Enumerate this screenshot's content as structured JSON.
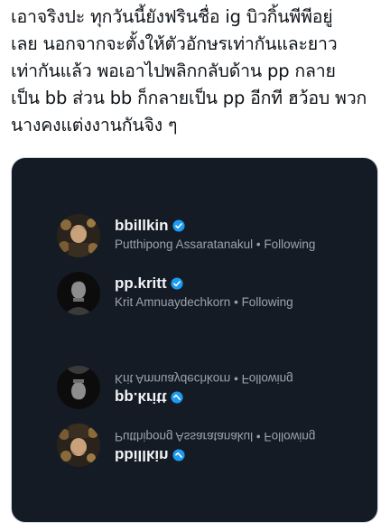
{
  "tweet": {
    "text": "เอาจริงปะ ทุกวันนี้ยังฟรินชื่อ ig บิวกิ้นพีพีอยู่\nเลย นอกจากจะตั้งให้ตัวอักษรเท่ากันและยาว\nเท่ากันแล้ว พอเอาไปพลิกกลับด้าน pp กลาย\nเป็น bb ส่วน bb ก็กลายเป็น pp อีกที ฮว้อบ พวก\nนางคงแต่งงานกันจิง ๆ"
  },
  "screenshot": {
    "accounts": [
      {
        "username": "bbillkin",
        "fullname": "Putthipong Assaratanakul",
        "status": "Following",
        "flipped": false,
        "avatar": "avatar-bbillkin"
      },
      {
        "username": "pp.kritt",
        "fullname": "Krit Amnuaydechkorn",
        "status": "Following",
        "flipped": false,
        "avatar": "avatar-ppkritt"
      },
      {
        "username": "pp.kritt",
        "fullname": "Krit Amnuaydechkorn",
        "status": "Following",
        "flipped": true,
        "avatar": "avatar-ppkritt"
      },
      {
        "username": "bbillkin",
        "fullname": "Putthipong Assaratanakul",
        "status": "Following",
        "flipped": true,
        "avatar": "avatar-bbillkin"
      }
    ],
    "separator": " • ",
    "colors": {
      "background": "#151b24",
      "verified": "#1d9bf0",
      "username": "#f1f3f5",
      "subtext": "#9aa3ad"
    },
    "icons": {
      "verified": "verified-badge-icon"
    }
  }
}
